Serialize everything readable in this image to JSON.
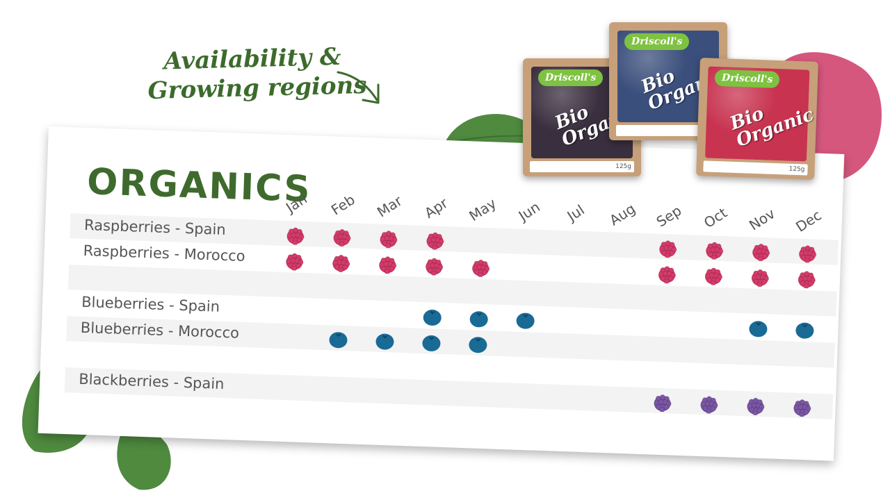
{
  "headline": {
    "line1": "Availability &",
    "line2": "Growing regions",
    "color": "#3c6b2c"
  },
  "card": {
    "title": "ORGANICS"
  },
  "months": [
    "Jan",
    "Feb",
    "Mar",
    "Apr",
    "May",
    "Jun",
    "Jul",
    "Aug",
    "Sep",
    "Oct",
    "Nov",
    "Dec"
  ],
  "rows": [
    {
      "label": "Raspberries - Spain",
      "fruit": "raspberry",
      "months": [
        1,
        2,
        3,
        4,
        9,
        10,
        11,
        12
      ]
    },
    {
      "label": "Raspberries - Morocco",
      "fruit": "raspberry",
      "months": [
        1,
        2,
        3,
        4,
        5,
        9,
        10,
        11,
        12
      ]
    },
    {
      "label": "",
      "fruit": "",
      "months": []
    },
    {
      "label": "Blueberries - Spain",
      "fruit": "blueberry",
      "months": [
        4,
        5,
        6,
        11,
        12
      ]
    },
    {
      "label": "Blueberries - Morocco",
      "fruit": "blueberry",
      "months": [
        2,
        3,
        4,
        5
      ]
    },
    {
      "label": "",
      "fruit": "",
      "months": []
    },
    {
      "label": "Blackberries - Spain",
      "fruit": "blackberry",
      "months": [
        9,
        10,
        11,
        12
      ]
    }
  ],
  "fruit_colors": {
    "raspberry": "#d43b6a",
    "blueberry": "#1a6a96",
    "blackberry": "#7b56a5"
  },
  "packs": [
    {
      "brand": "Driscoll's",
      "label": "Bio Organic",
      "size": "125g",
      "fruit": "blackberry",
      "fill": "#3a2f3f"
    },
    {
      "brand": "Driscoll's",
      "label": "Bio Organic",
      "size": "125g",
      "fruit": "blueberry",
      "fill": "#3b4f7c"
    },
    {
      "brand": "Driscoll's",
      "label": "Bio Organic",
      "size": "125g",
      "fruit": "raspberry",
      "fill": "#c83350"
    }
  ],
  "decor": {
    "leaf_color": "#4f8a3f",
    "splash_color": "#d0456f"
  }
}
